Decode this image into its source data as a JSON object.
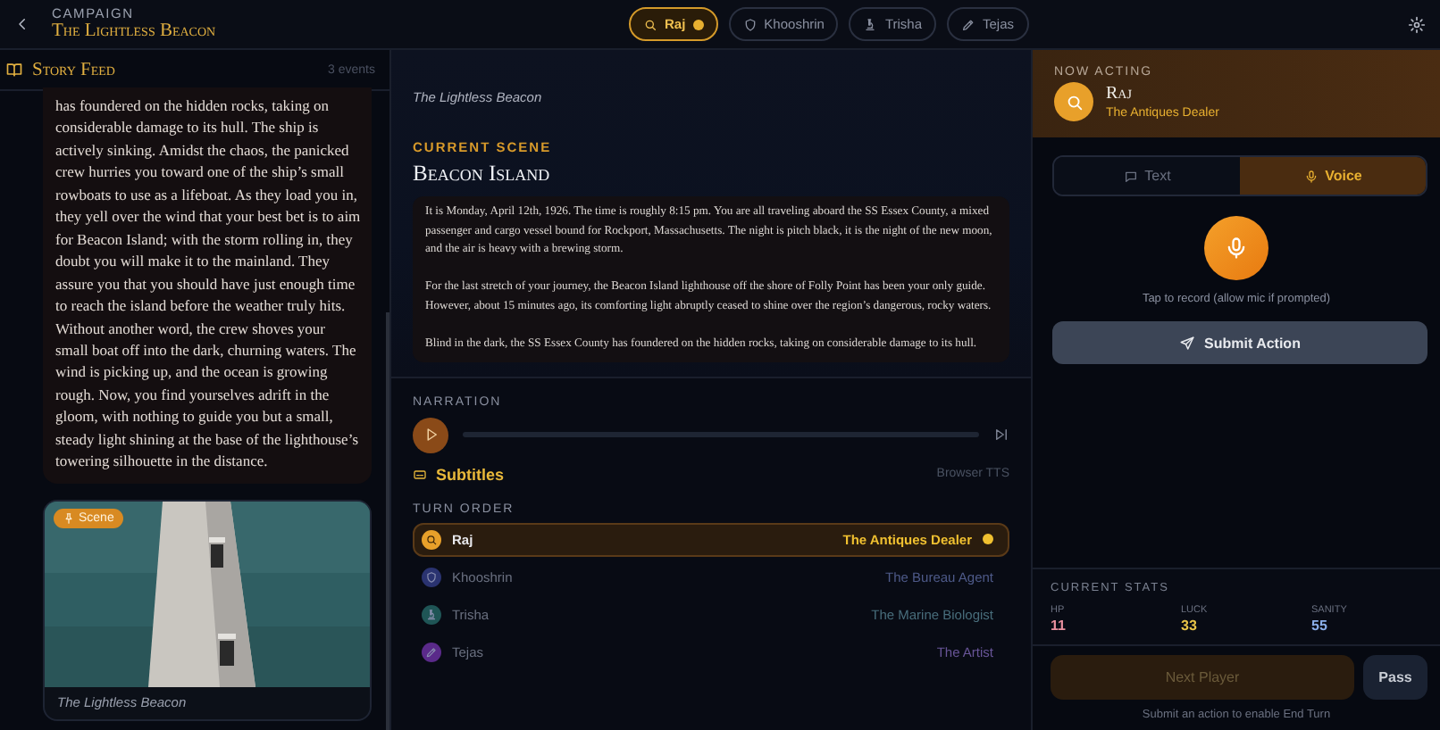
{
  "header": {
    "subtitle": "CAMPAIGN",
    "title": "The Lightless Beacon",
    "players": [
      {
        "name": "Raj",
        "selected": true
      },
      {
        "name": "Khooshrin",
        "selected": false
      },
      {
        "name": "Trisha",
        "selected": false
      },
      {
        "name": "Tejas",
        "selected": false
      }
    ]
  },
  "story_feed": {
    "title": "Story Feed",
    "count": "3 events",
    "entries": [
      {
        "kind": "text",
        "text": "has foundered on the hidden rocks, taking on considerable damage to its hull. The ship is actively sinking. Amidst the chaos, the panicked crew hurries you toward one of the ship’s small rowboats to use as a lifeboat. As they load you in, they yell over the wind that your best bet is to aim for Beacon Island; with the storm rolling in, they doubt you will make it to the mainland. They assure you that you should have just enough time to reach the island before the weather truly hits. Without another word, the crew shoves your small boat off into the dark, churning waters. The wind is picking up, and the ocean is growing rough. Now, you find yourselves adrift in the gloom, with nothing to guide you but a small, steady light shining at the base of the lighthouse’s towering silhouette in the distance."
      },
      {
        "kind": "scene",
        "badge": "Scene",
        "caption": "The Lightless Beacon"
      }
    ]
  },
  "scene": {
    "banner_caption": "The Lightless Beacon",
    "label": "CURRENT SCENE",
    "title": "Beacon Island",
    "paragraphs": [
      "It is Monday, April 12th, 1926. The time is roughly 8:15 pm. You are all traveling aboard the SS Essex County, a mixed passenger and cargo vessel bound for Rockport, Massachusetts. The night is pitch black, it is the night of the new moon, and the air is heavy with a brewing storm.",
      "For the last stretch of your journey, the Beacon Island lighthouse off the shore of Folly Point has been your only guide. However, about 15 minutes ago, its comforting light abruptly ceased to shine over the region’s dangerous, rocky waters.",
      "Blind in the dark, the SS Essex County has foundered on the hidden rocks, taking on considerable damage to its hull."
    ]
  },
  "narration": {
    "label": "NARRATION",
    "level": 0,
    "subtitles": "Subtitles",
    "engine": "Browser TTS"
  },
  "turn_order": {
    "label": "TURN ORDER",
    "players": [
      {
        "name": "Raj",
        "role": "The Antiques Dealer",
        "color": "#e8a02a",
        "selected": true
      },
      {
        "name": "Khooshrin",
        "role": "The Bureau Agent",
        "color": "#2a3370",
        "selected": false
      },
      {
        "name": "Trisha",
        "role": "The Marine Biologist",
        "color": "#1f5556",
        "selected": false
      },
      {
        "name": "Tejas",
        "role": "The Artist",
        "color": "#5a2a8a",
        "selected": false
      }
    ]
  },
  "action": {
    "label": "NOW ACTING",
    "name": "Raj",
    "role": "The Antiques Dealer",
    "modes": [
      {
        "label": "Text",
        "selected": false
      },
      {
        "label": "Voice",
        "selected": true
      }
    ],
    "hint": "Tap to record (allow mic if prompted)",
    "submit": "Submit Action"
  },
  "stats": {
    "label": "CURRENT STATS",
    "items": [
      {
        "name": "HP",
        "value": "11",
        "color": "#e8909e"
      },
      {
        "name": "LUCK",
        "value": "33",
        "color": "#e8c448"
      },
      {
        "name": "SANITY",
        "value": "55",
        "color": "#8aaee8"
      }
    ]
  },
  "footer": {
    "next": {
      "label": "Next Player",
      "disabled": true
    },
    "pass": {
      "label": "Pass",
      "disabled": false
    },
    "note": "Submit an action to enable End Turn"
  }
}
